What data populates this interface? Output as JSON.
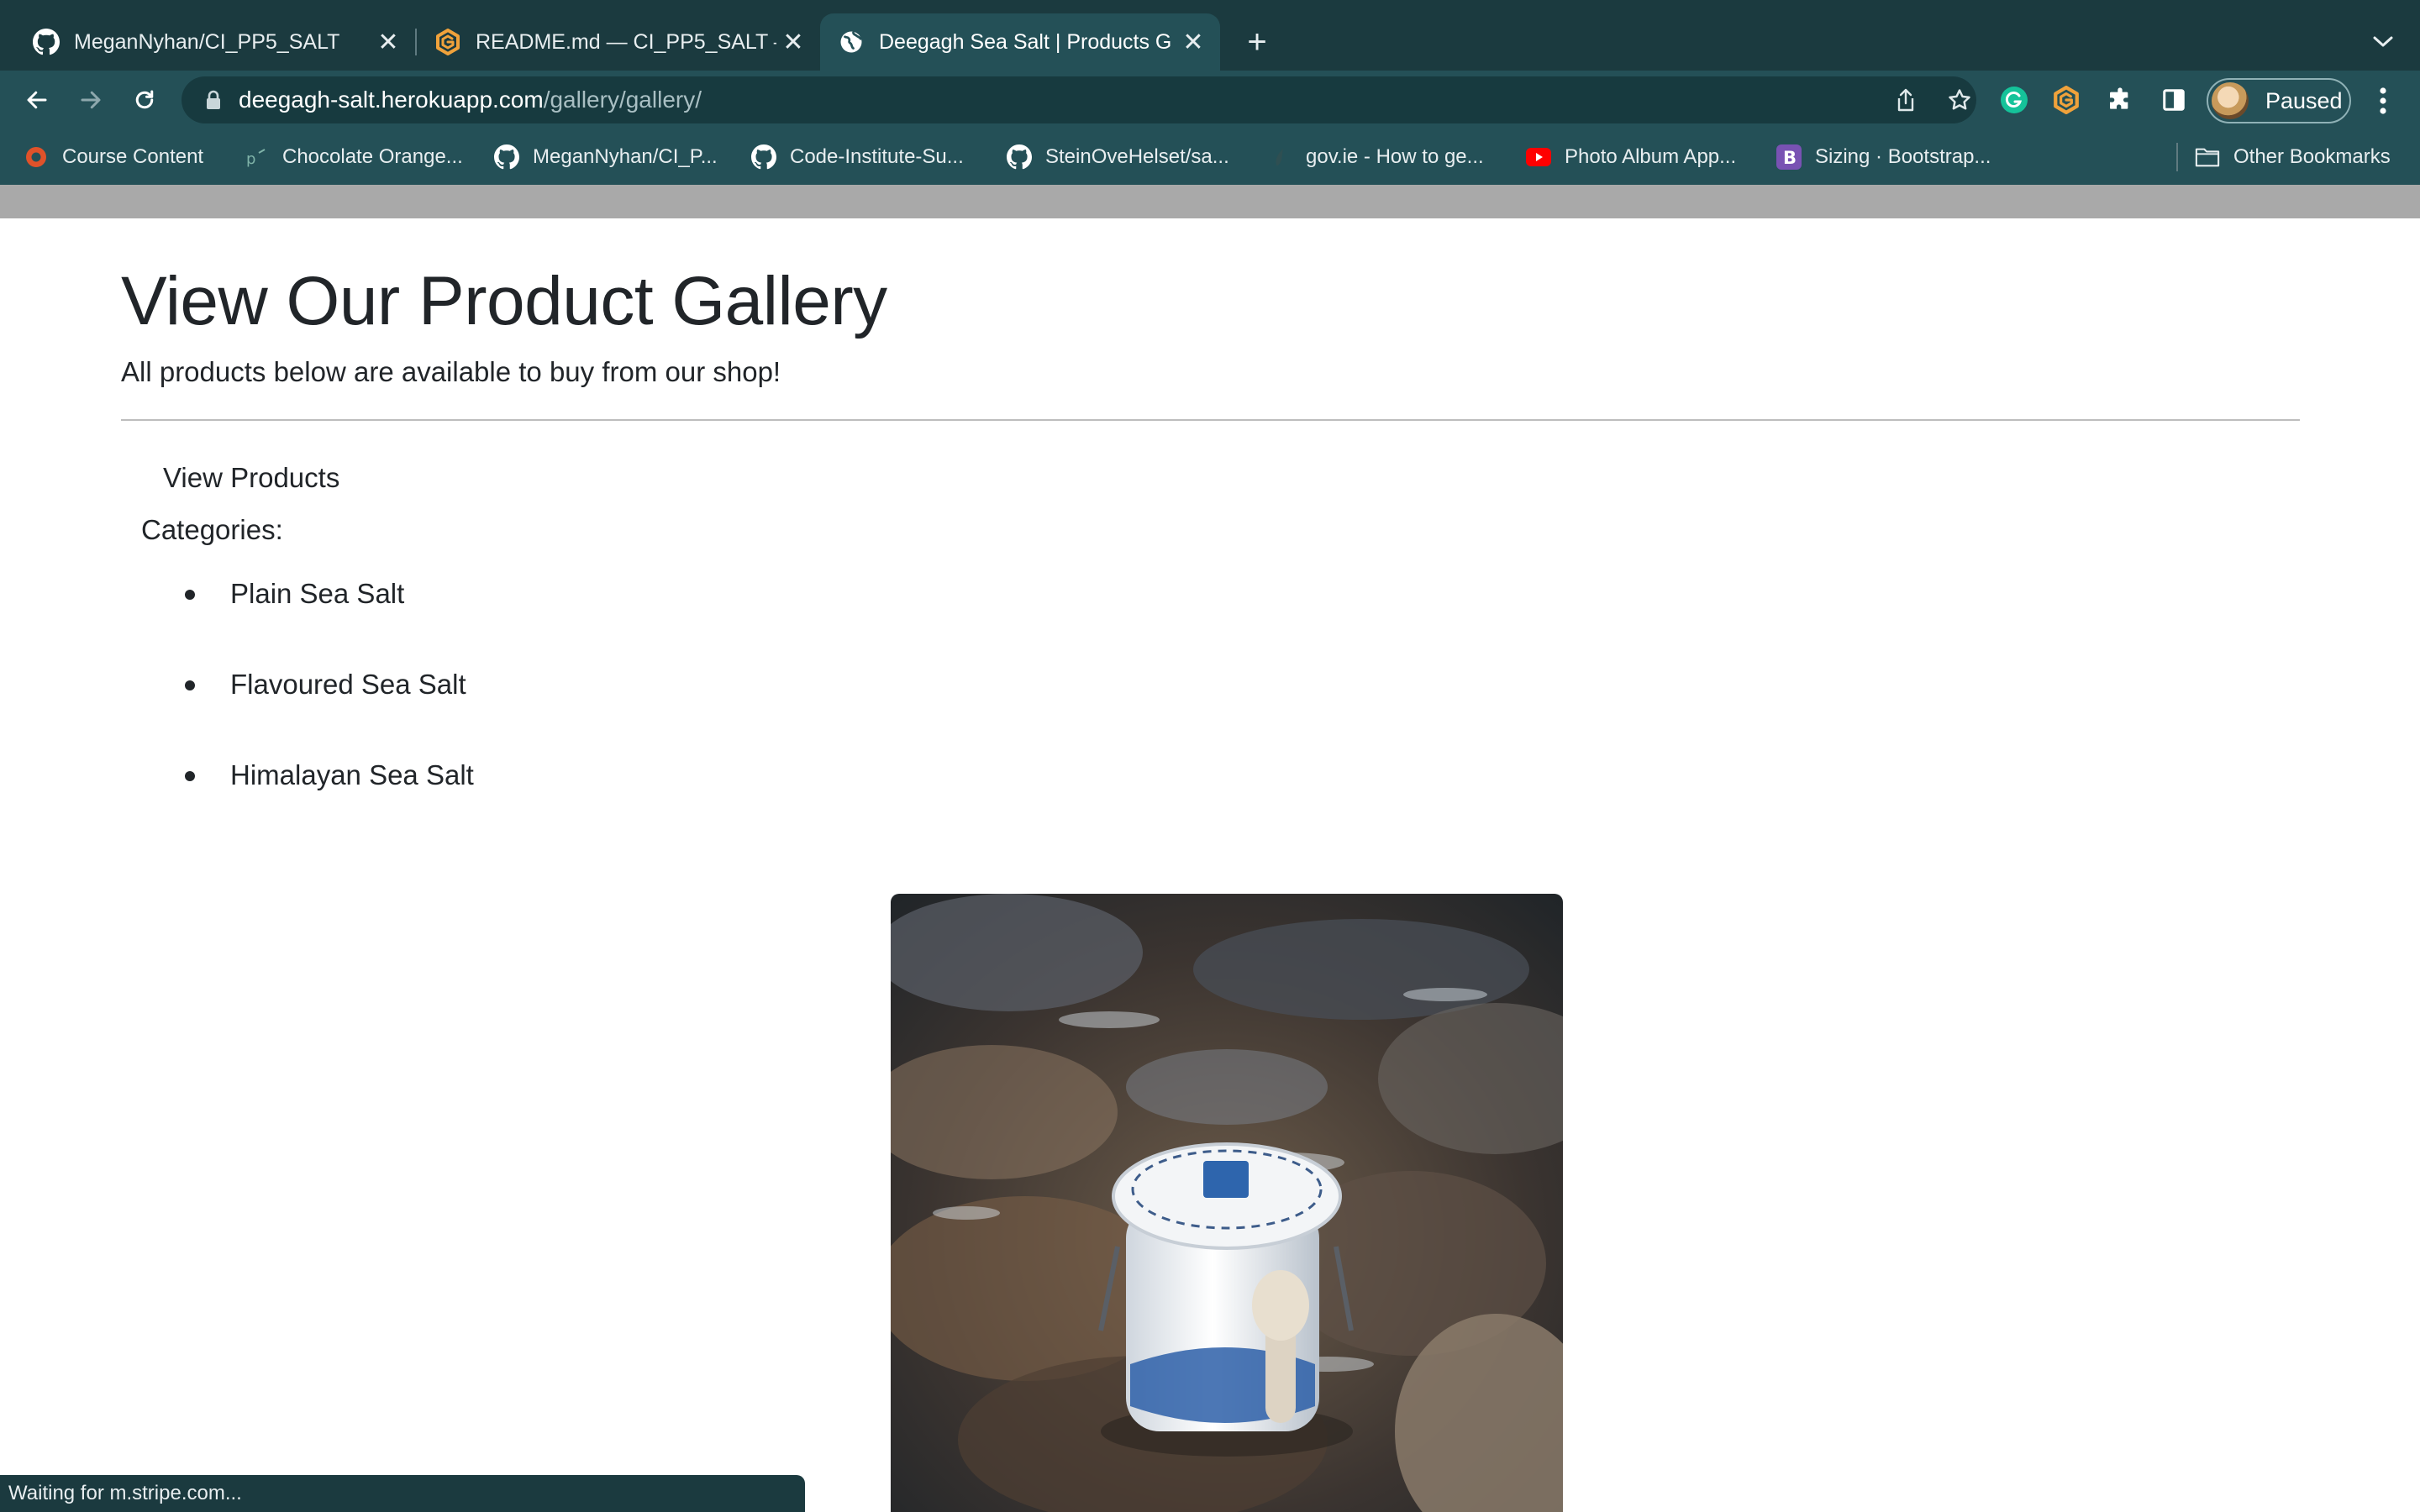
{
  "browser": {
    "tabs": [
      {
        "title": "MeganNyhan/CI_PP5_SALT",
        "icon": "github-icon",
        "active": false
      },
      {
        "title": "README.md — CI_PP5_SALT —",
        "icon": "gitpod-icon",
        "active": false
      },
      {
        "title": "Deegagh Sea Salt | Products G",
        "icon": "globe-icon",
        "active": true
      }
    ],
    "url": {
      "host": "deegagh-salt.herokuapp.com",
      "path": "/gallery/gallery/"
    },
    "profile_label": "Paused",
    "bookmarks": [
      {
        "label": "Course Content",
        "icon": "course-icon"
      },
      {
        "label": "Chocolate Orange...",
        "icon": "pixel-icon"
      },
      {
        "label": "MeganNyhan/CI_P...",
        "icon": "github-icon"
      },
      {
        "label": "Code-Institute-Su...",
        "icon": "github-icon"
      },
      {
        "label": "SteinOveHelset/sa...",
        "icon": "github-icon"
      },
      {
        "label": "gov.ie - How to ge...",
        "icon": "govie-icon"
      },
      {
        "label": "Photo Album App...",
        "icon": "youtube-icon"
      },
      {
        "label": "Sizing · Bootstrap...",
        "icon": "bootstrap-icon"
      },
      {
        "label": "Other Bookmarks",
        "icon": "folder-icon"
      }
    ],
    "status_text": "Waiting for m.stripe.com..."
  },
  "page": {
    "heading": "View Our Product Gallery",
    "lead": "All products below are available to buy from our shop!",
    "view_products": "View Products",
    "categories_label": "Categories:",
    "categories": [
      "Plain Sea Salt",
      "Flavoured Sea Salt",
      "Himalayan Sea Salt"
    ]
  },
  "colors": {
    "tabstrip": "#1b3a3f",
    "toolbar": "#245057",
    "omnibox": "#173a3f",
    "text": "#212529"
  }
}
